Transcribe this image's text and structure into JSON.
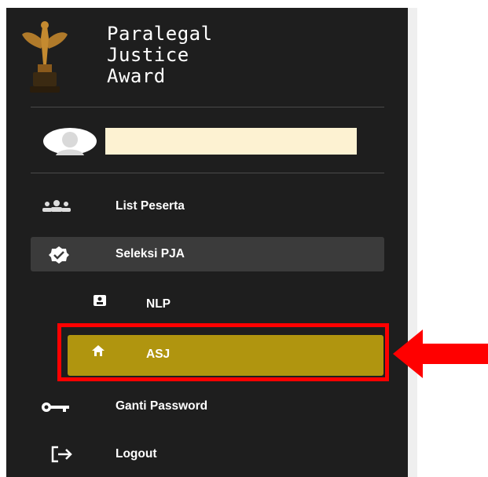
{
  "brand": {
    "title": "Paralegal\nJustice\nAward",
    "logo_icon": "trophy-icon"
  },
  "user": {
    "avatar_icon": "user-avatar-icon",
    "name": ""
  },
  "nav": {
    "list_peserta": {
      "label": "List Peserta",
      "icon": "users-icon"
    },
    "seleksi_pja": {
      "label": "Seleksi PJA",
      "icon": "badge-check-icon"
    },
    "nlp": {
      "label": "NLP",
      "icon": "id-card-icon"
    },
    "asj": {
      "label": "ASJ",
      "icon": "home-icon"
    },
    "ganti_password": {
      "label": "Ganti Password",
      "icon": "key-icon"
    },
    "logout": {
      "label": "Logout",
      "icon": "logout-icon"
    }
  },
  "colors": {
    "sidebar_bg": "#1e1e1e",
    "active_bg": "#b0950f",
    "group_bg": "#3b3b3b",
    "highlight": "#ff0000",
    "name_box": "#fdf2d2"
  }
}
